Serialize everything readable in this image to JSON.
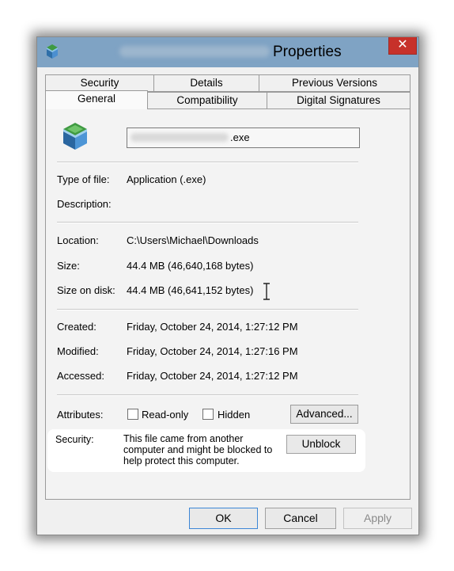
{
  "window": {
    "title": "Properties",
    "close_glyph": "✕",
    "app_icon": "app-package-icon"
  },
  "tabs": {
    "row1": [
      "Security",
      "Details",
      "Previous Versions"
    ],
    "row2": [
      "General",
      "Compatibility",
      "Digital Signatures"
    ],
    "active": "General"
  },
  "general": {
    "file_ext": ".exe",
    "file_icon": "app-package-icon",
    "type_label": "Type of file:",
    "type_value": "Application (.exe)",
    "description_label": "Description:",
    "location_label": "Location:",
    "location_value": "C:\\Users\\Michael\\Downloads",
    "size_label": "Size:",
    "size_value": "44.4 MB (46,640,168 bytes)",
    "size_on_disk_label": "Size on disk:",
    "size_on_disk_value": "44.4 MB (46,641,152 bytes)",
    "created_label": "Created:",
    "created_value": "Friday, October 24, 2014, 1:27:12 PM",
    "modified_label": "Modified:",
    "modified_value": "Friday, October 24, 2014, 1:27:16 PM",
    "accessed_label": "Accessed:",
    "accessed_value": "Friday, October 24, 2014, 1:27:12 PM",
    "attributes_label": "Attributes:",
    "readonly_label": "Read-only",
    "hidden_label": "Hidden",
    "advanced_label": "Advanced...",
    "security_label": "Security:",
    "security_message": "This file came from another computer and might be blocked to help protect this computer.",
    "unblock_label": "Unblock"
  },
  "footer": {
    "ok_label": "OK",
    "cancel_label": "Cancel",
    "apply_label": "Apply"
  },
  "colors": {
    "titlebar": "#7fa3c4",
    "close_button": "#c7312a",
    "dialog_background": "#f0f0f0",
    "default_button_border": "#3c86d6"
  }
}
